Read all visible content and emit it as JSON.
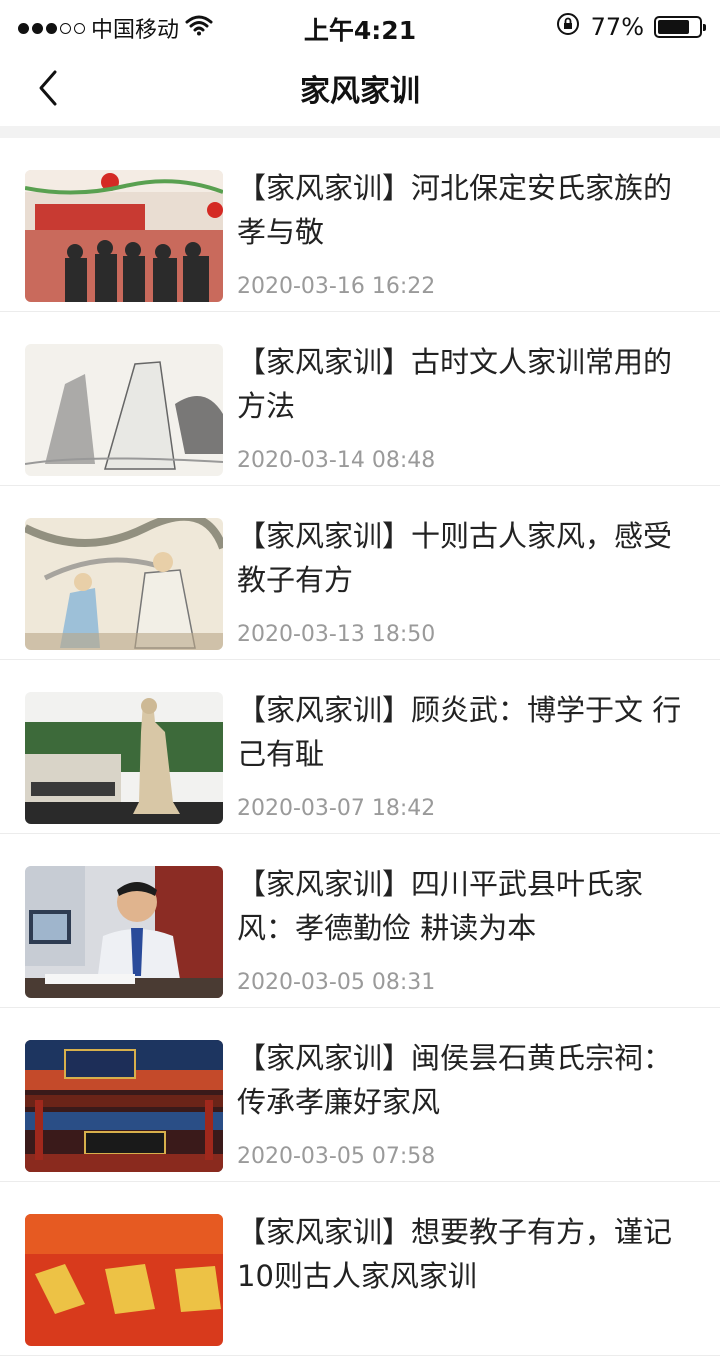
{
  "status_bar": {
    "carrier": "中国移动",
    "time": "上午4:21",
    "battery": "77%",
    "battery_level": 0.77
  },
  "nav": {
    "title": "家风家训",
    "back_icon": "chevron-left-icon"
  },
  "articles": [
    {
      "title": "【家风家训】河北保定安氏家族的孝与敬",
      "date": "2020-03-16 16:22"
    },
    {
      "title": "【家风家训】古时文人家训常用的方法",
      "date": "2020-03-14 08:48"
    },
    {
      "title": "【家风家训】十则古人家风，感受教子有方",
      "date": "2020-03-13 18:50"
    },
    {
      "title": "【家风家训】顾炎武：博学于文 行己有耻",
      "date": "2020-03-07 18:42"
    },
    {
      "title": "【家风家训】四川平武县叶氏家风：孝德勤俭 耕读为本",
      "date": "2020-03-05 08:31"
    },
    {
      "title": "【家风家训】闽侯昙石黄氏宗祠：传承孝廉好家风",
      "date": "2020-03-05 07:58"
    },
    {
      "title": "【家风家训】想要教子有方，谨记10则古人家风家训",
      "date": ""
    }
  ]
}
